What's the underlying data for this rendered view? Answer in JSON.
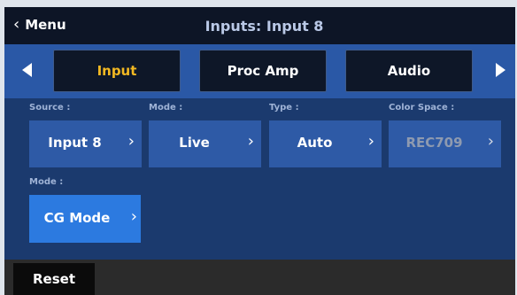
{
  "header": {
    "back_label": "Menu",
    "back_icon": "chevron-left-icon",
    "title": "Inputs: Input 8"
  },
  "tabs": {
    "items": [
      {
        "label": "Input",
        "active": true
      },
      {
        "label": "Proc Amp",
        "active": false
      },
      {
        "label": "Audio",
        "active": false
      }
    ],
    "prev_icon": "triangle-left-icon",
    "next_icon": "triangle-right-icon"
  },
  "settings": {
    "source": {
      "label": "Source :",
      "value": "Input 8"
    },
    "mode": {
      "label": "Mode :",
      "value": "Live"
    },
    "type": {
      "label": "Type :",
      "value": "Auto"
    },
    "color_space": {
      "label": "Color Space :",
      "value": "REC709",
      "disabled": true
    },
    "mode2": {
      "label": "Mode :",
      "value": "CG Mode"
    }
  },
  "footer": {
    "reset_label": "Reset"
  },
  "colors": {
    "active_tab_text": "#f2b822",
    "panel_bg": "#1b3a6e",
    "field_bg": "#2e5aa6",
    "selected_bg": "#2c7ae0"
  }
}
